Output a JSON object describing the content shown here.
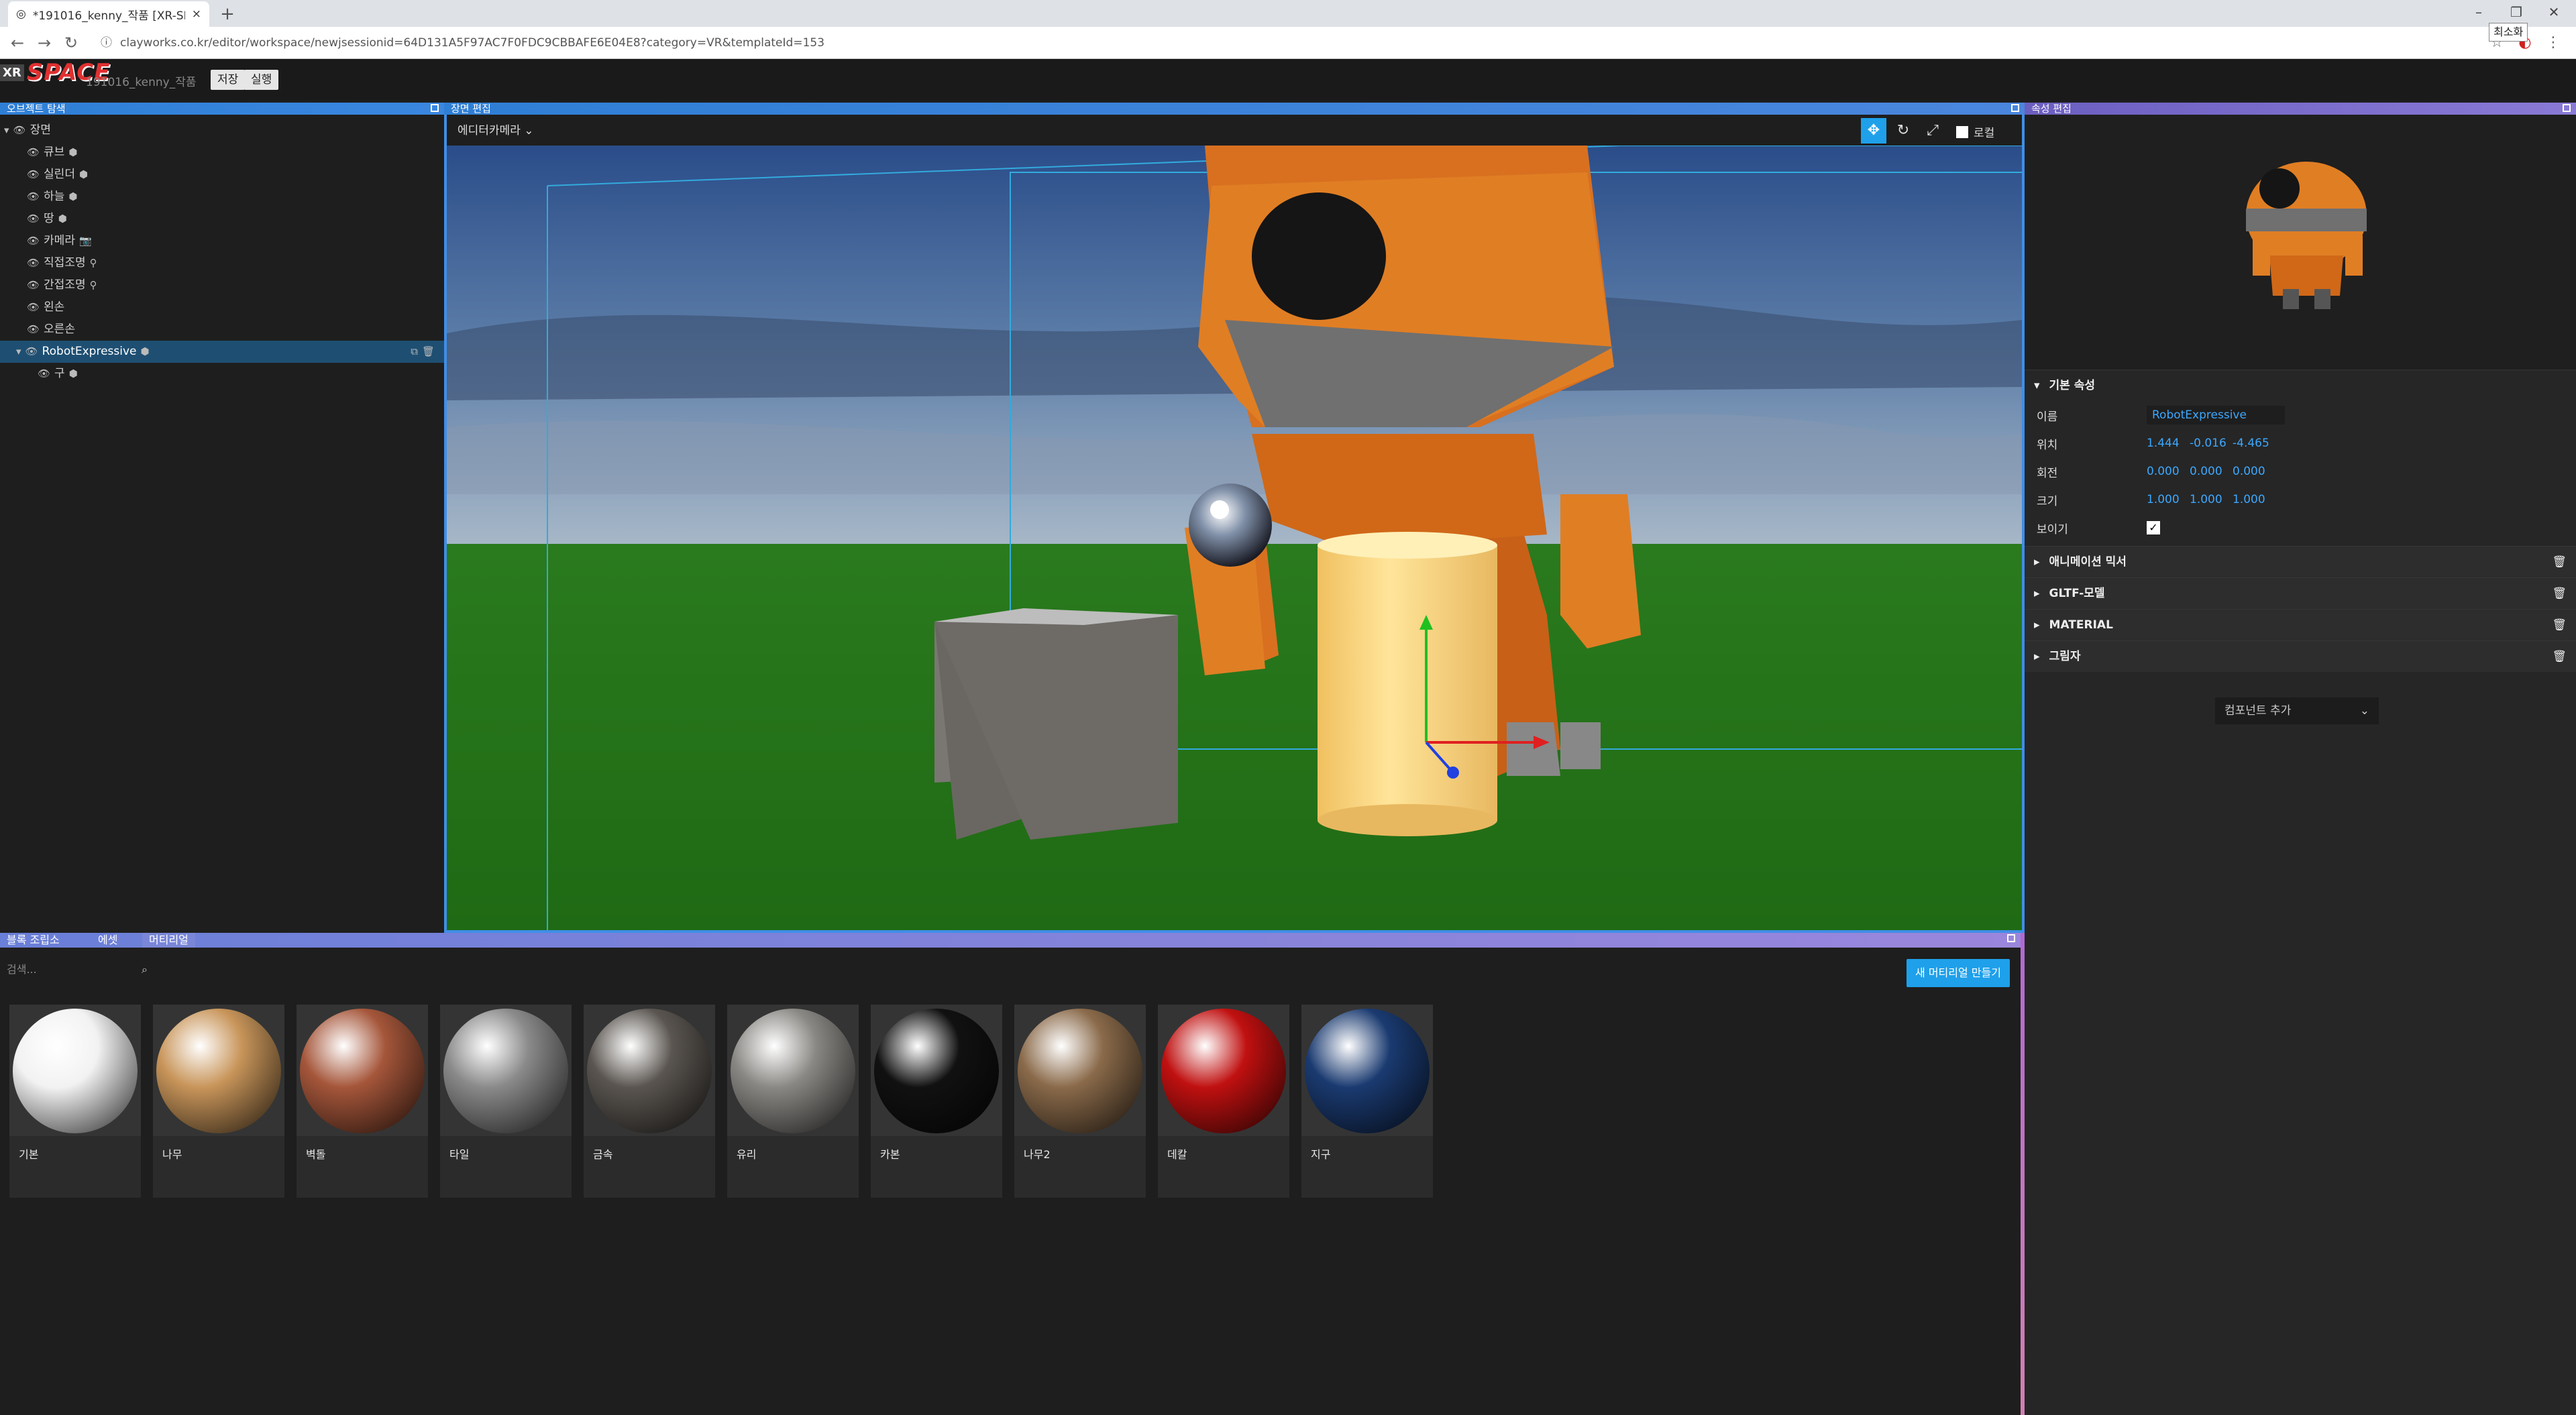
{
  "browser": {
    "tab_title": "*191016_kenny_작품 [XR-SPACE]",
    "tab_close": "×",
    "new_tab": "+",
    "url": "clayworks.co.kr/editor/workspace/newjsessionid=64D131A5F97AC7F0FDC9CBBAFE6E04E8?category=VR&templateId=153",
    "tooltip": "최소화",
    "minimize": "–",
    "restore": "❐",
    "close": "✕"
  },
  "app": {
    "logo_xr": "XR",
    "logo_space": "SPACE",
    "project_name": "191016_kenny_작품",
    "save_label": "저장",
    "run_label": "실행"
  },
  "left_panel": {
    "title": "오브젝트 탐색",
    "root": "장면",
    "items": [
      {
        "label": "큐브",
        "icon": "box-icon"
      },
      {
        "label": "실린더",
        "icon": "box-icon"
      },
      {
        "label": "하늘",
        "icon": "box-icon"
      },
      {
        "label": "땅",
        "icon": "box-icon"
      },
      {
        "label": "카메라",
        "icon": "camera-icon"
      },
      {
        "label": "직접조명",
        "icon": "bulb-icon"
      },
      {
        "label": "간접조명",
        "icon": "bulb-icon"
      },
      {
        "label": "왼손",
        "icon": ""
      },
      {
        "label": "오른손",
        "icon": ""
      }
    ],
    "selected": "RobotExpressive",
    "child": "구"
  },
  "scene_panel": {
    "title": "장면 편집",
    "camera_select": "에디터카메라",
    "local_label": "로컬"
  },
  "right_panel": {
    "title": "속성 편집",
    "basic_section": "기본 속성",
    "name_label": "이름",
    "name_value": "RobotExpressive",
    "position_label": "위치",
    "position": [
      "1.444",
      "-0.016",
      "-4.465"
    ],
    "rotation_label": "회전",
    "rotation": [
      "0.000",
      "0.000",
      "0.000"
    ],
    "scale_label": "크기",
    "scale": [
      "1.000",
      "1.000",
      "1.000"
    ],
    "visible_label": "보이기",
    "visible": true,
    "sections": [
      "애니메이션 믹서",
      "GLTF-모델",
      "MATERIAL",
      "그림자"
    ],
    "add_component": "컴포넌트 추가"
  },
  "bottom_panel": {
    "tabs": [
      "블록 조립소",
      "에셋",
      "머티리얼"
    ],
    "active_tab": "머티리얼",
    "search_placeholder": "검색...",
    "new_material": "새 머티리얼 만들기",
    "materials": [
      {
        "name": "기본",
        "color": "#f2f2f2"
      },
      {
        "name": "나무",
        "color": "#c8955a"
      },
      {
        "name": "벽돌",
        "color": "#a5563a"
      },
      {
        "name": "타일",
        "color": "#8a8a8a"
      },
      {
        "name": "금속",
        "color": "#5a5550"
      },
      {
        "name": "유리",
        "color": "#8a8884"
      },
      {
        "name": "카본",
        "color": "#111111"
      },
      {
        "name": "나무2",
        "color": "#8a6a4a"
      },
      {
        "name": "데칼",
        "color": "#c01010"
      },
      {
        "name": "지구",
        "color": "#1a3a70"
      }
    ]
  }
}
